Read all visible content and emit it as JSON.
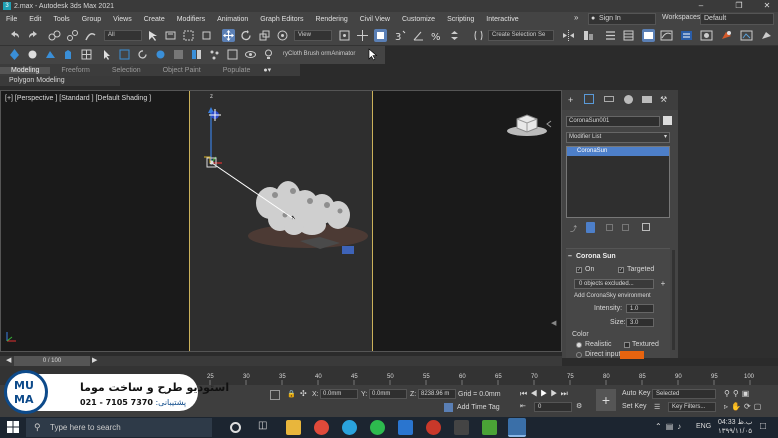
{
  "window": {
    "title": "2.max - Autodesk 3ds Max 2021",
    "icon_letter": "3"
  },
  "menu": [
    "File",
    "Edit",
    "Tools",
    "Group",
    "Views",
    "Create",
    "Modifiers",
    "Animation",
    "Graph Editors",
    "Rendering",
    "Civil View",
    "Customize",
    "Scripting",
    "Interactive"
  ],
  "account": {
    "signin_label": "Sign In",
    "workspaces_label": "Workspaces:",
    "workspace_value": "Default"
  },
  "toolbar": {
    "selection_filter": "All",
    "ref_coord": "View",
    "named_selection": "Create Selection Se",
    "toolbar2_text": "ryCloth Brush  ormAnimator"
  },
  "ribbon": {
    "tabs": [
      "Modeling",
      "Freeform",
      "Selection",
      "Object Paint",
      "Populate"
    ],
    "active_tab": "Modeling",
    "subpanel": "Polygon Modeling"
  },
  "viewport": {
    "label": "[+] [Perspective ] [Standard ] [Default Shading ]",
    "gizmo_axis_z": "z"
  },
  "command_panel": {
    "object_name": "CoronaSun001",
    "modifier_list": "Modifier List",
    "stack_item": "CoronaSun",
    "rollout_title": "Corona Sun",
    "on_label": "On",
    "on_checked": true,
    "targeted_label": "Targeted",
    "targeted_checked": true,
    "objects_excluded": "0 objects excluded...",
    "add_sky_button": "Add CoronaSky environment",
    "intensity_label": "Intensity:",
    "intensity_value": "1.0",
    "size_label": "Size:",
    "size_value": "3.0",
    "color_label": "Color",
    "realistic_label": "Realistic",
    "textured_label": "Textured",
    "direct_input_label": "Direct input",
    "color_swatch": "#e8640f"
  },
  "timeline": {
    "frame_counter": "0 / 100",
    "ticks": [
      "25",
      "30",
      "35",
      "40",
      "45",
      "50",
      "55",
      "60",
      "65",
      "70",
      "75",
      "80",
      "85",
      "90",
      "95",
      "100"
    ]
  },
  "status": {
    "x_label": "X:",
    "x_value": "0.0mm",
    "y_label": "Y:",
    "y_value": "0.0mm",
    "z_label": "Z:",
    "z_value": "8238.96 m",
    "grid": "Grid = 0.0mm",
    "add_time_tag": "Add Time Tag",
    "frame_value": "0",
    "auto_key": "Auto Key",
    "set_key": "Set Key",
    "key_mode": "Selected",
    "key_filters": "Key Filters..."
  },
  "logo": {
    "mark_line1": "MU",
    "mark_line2": "MA",
    "studio_name": "استودیو طرح و ساخت موما",
    "support_label": "پشتیبانی:",
    "support_phone": "021 - 7105 7370"
  },
  "taskbar": {
    "search_placeholder": "Type here to search",
    "language": "ENG",
    "time": "04:33 ب.ظ",
    "date": "۱۳۹۹/۱۱/۰۵",
    "apps": [
      "cortana-icon",
      "task-view-icon",
      "file-explorer-icon",
      "chrome-icon",
      "telegram-icon",
      "whatsapp-icon",
      "store-icon",
      "app-red-icon",
      "app-rocket-icon",
      "app-green-c-icon",
      "3dsmax-icon"
    ]
  },
  "colors": {
    "accent": "#5a7fb5",
    "safe_frame": "#cbb15a",
    "logo_blue": "#0d4a8a",
    "stack_highlight": "#4d7fc9"
  }
}
